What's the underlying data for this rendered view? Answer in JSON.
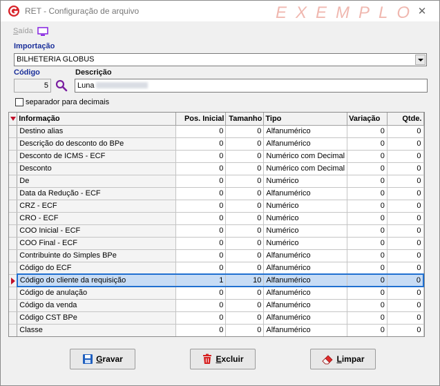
{
  "window": {
    "title": "RET - Configuração de arquivo",
    "watermark": "EXEMPLO",
    "close_glyph": "✕"
  },
  "menu": {
    "saida_first": "S",
    "saida_rest": "aída"
  },
  "form": {
    "importacao_label": "Importação",
    "importacao_value": "BILHETERIA GLOBUS",
    "codigo_label": "Código",
    "codigo_value": "5",
    "descricao_label": "Descrição",
    "descricao_value": "Luna",
    "checkbox_label": "separador para decimais",
    "checkbox_checked": false
  },
  "grid": {
    "columns": [
      "Informação",
      "Pos. Inicial",
      "Tamanho",
      "Tipo",
      "Variação",
      "Qtde."
    ],
    "rows": [
      [
        "Destino alias",
        "0",
        "0",
        "Alfanumérico",
        "0",
        "0"
      ],
      [
        "Descrição do desconto do BPe",
        "0",
        "0",
        "Alfanumérico",
        "0",
        "0"
      ],
      [
        "Desconto de ICMS - ECF",
        "0",
        "0",
        "Numérico com Decimal",
        "0",
        "0"
      ],
      [
        "Desconto",
        "0",
        "0",
        "Numérico com Decimal",
        "0",
        "0"
      ],
      [
        "De",
        "0",
        "0",
        "Numérico",
        "0",
        "0"
      ],
      [
        "Data da Redução - ECF",
        "0",
        "0",
        "Alfanumérico",
        "0",
        "0"
      ],
      [
        "CRZ - ECF",
        "0",
        "0",
        "Numérico",
        "0",
        "0"
      ],
      [
        "CRO - ECF",
        "0",
        "0",
        "Numérico",
        "0",
        "0"
      ],
      [
        "COO Inicial - ECF",
        "0",
        "0",
        "Numérico",
        "0",
        "0"
      ],
      [
        "COO Final - ECF",
        "0",
        "0",
        "Numérico",
        "0",
        "0"
      ],
      [
        "Contribuinte do Simples BPe",
        "0",
        "0",
        "Alfanumérico",
        "0",
        "0"
      ],
      [
        "Código do ECF",
        "0",
        "0",
        "Alfanumérico",
        "0",
        "0"
      ],
      [
        "Código do cliente da requisição",
        "1",
        "10",
        "Alfanumérico",
        "0",
        "0"
      ],
      [
        "Código de anulação",
        "0",
        "0",
        "Alfanumérico",
        "0",
        "0"
      ],
      [
        "Código da venda",
        "0",
        "0",
        "Alfanumérico",
        "0",
        "0"
      ],
      [
        "Código CST BPe",
        "0",
        "0",
        "Alfanumérico",
        "0",
        "0"
      ],
      [
        "Classe",
        "0",
        "0",
        "Alfanumérico",
        "0",
        "0"
      ]
    ],
    "selected_row": 12
  },
  "buttons": {
    "gravar_first": "G",
    "gravar_rest": "ravar",
    "excluir_first": "E",
    "excluir_rest": "xcluir",
    "limpar_first": "L",
    "limpar_rest": "impar"
  },
  "colors": {
    "accent": "#1a2f9a",
    "selection": "#c7dcf5",
    "selection_border": "#1f6fd0",
    "marker": "#c0102a"
  },
  "icons": [
    "app-logo-icon",
    "monitor-icon",
    "search-icon",
    "save-icon",
    "delete-icon",
    "eraser-icon"
  ]
}
